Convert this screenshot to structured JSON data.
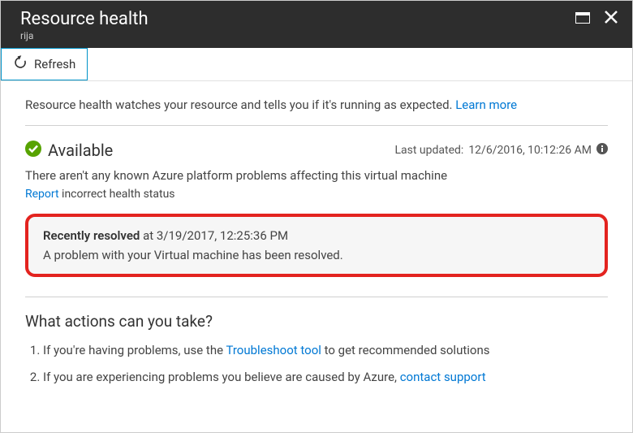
{
  "header": {
    "title": "Resource health",
    "subtitle": "rija"
  },
  "toolbar": {
    "refresh_label": "Refresh"
  },
  "intro": {
    "text": "Resource health watches your resource and tells you if it's running as expected. ",
    "learn_more": "Learn more"
  },
  "status": {
    "label": "Available",
    "last_updated_prefix": "Last updated: ",
    "last_updated_value": "12/6/2016, 10:12:26 AM"
  },
  "problems": {
    "text": "There aren't any known Azure platform problems affecting this virtual machine"
  },
  "report": {
    "link": "Report",
    "suffix": " incorrect health status"
  },
  "resolved": {
    "label": "Recently resolved",
    "at": " at 3/19/2017, 12:25:36 PM",
    "message": "A problem with your Virtual machine has been resolved."
  },
  "actions": {
    "title": "What actions can you take?",
    "item1_prefix": "If you're having problems, use the ",
    "item1_link": "Troubleshoot tool",
    "item1_suffix": " to get recommended solutions",
    "item2_prefix": "If you are experiencing problems you believe are caused by Azure, ",
    "item2_link": "contact support"
  }
}
